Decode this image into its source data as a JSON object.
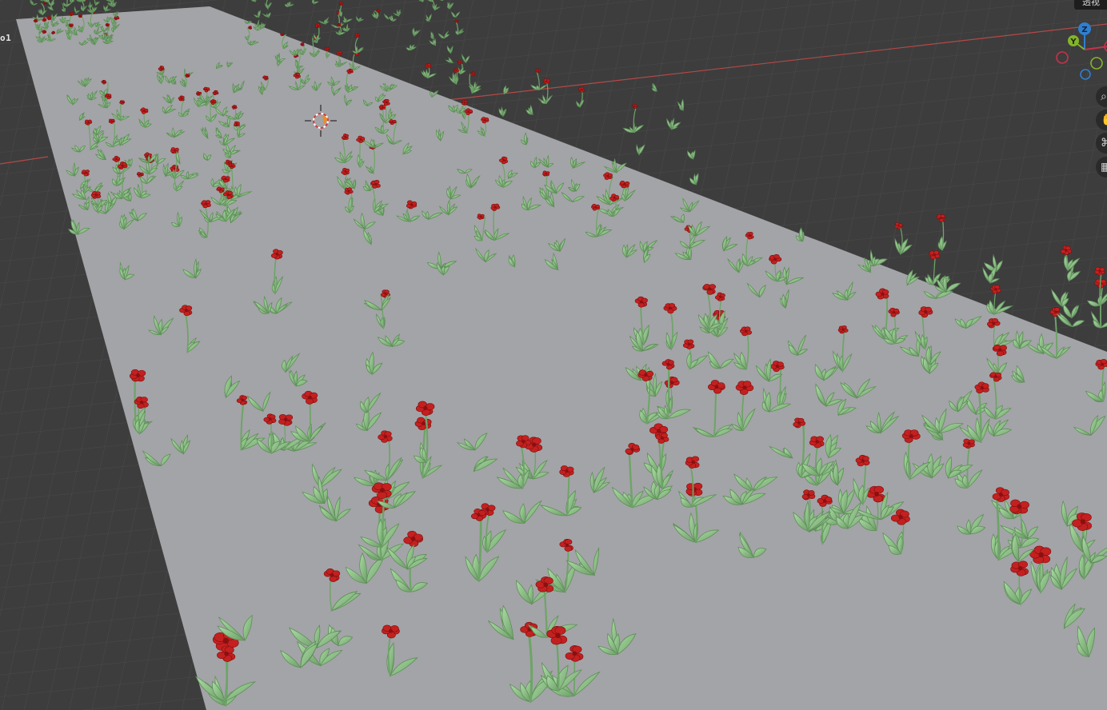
{
  "viewport": {
    "object_label": "o1",
    "view_menu_label": "透视",
    "background_color": "#3d3d3d",
    "ground_color": "#a3a4a7",
    "grid_color": "#4a4a4a",
    "x_axis_color": "#b54848",
    "y_axis_color": "#6e9a3c",
    "leaf_color": "#8fc88a",
    "leaf_dark_color": "#5f8e5a",
    "flower_color": "#c42020"
  },
  "gizmo": {
    "z_label": "Z",
    "y_label": "Y",
    "z_color": "#2f7fd1",
    "y_color": "#84b42a",
    "x_color": "#c8324a"
  },
  "nav_tools": [
    {
      "name": "zoom-icon",
      "glyph": "⌕"
    },
    {
      "name": "pan-hand-icon",
      "glyph": "✋"
    },
    {
      "name": "camera-icon",
      "glyph": "⌘"
    },
    {
      "name": "ortho-grid-icon",
      "glyph": "▦"
    }
  ]
}
